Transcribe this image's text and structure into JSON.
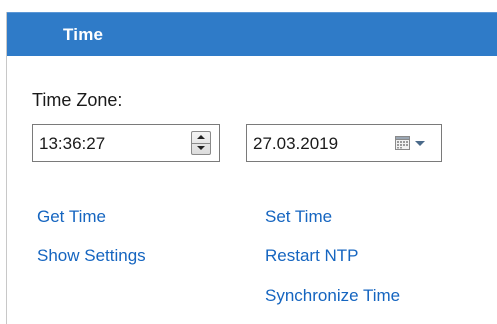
{
  "panel": {
    "title": "Time"
  },
  "time_zone": {
    "label": "Time Zone:"
  },
  "time_field": {
    "value": "13:36:27"
  },
  "date_field": {
    "value": "27.03.2019"
  },
  "actions": {
    "get_time": "Get Time",
    "set_time": "Set Time",
    "show_settings": "Show Settings",
    "restart_ntp": "Restart NTP",
    "synchronize_time": "Synchronize Time"
  },
  "icons": {
    "spinner": "up-down-spinner-icon",
    "calendar": "calendar-icon",
    "dropdown": "chevron-down-icon"
  },
  "colors": {
    "header_background": "#2f7bc8",
    "header_text": "#ffffff",
    "link": "#1565c0"
  }
}
